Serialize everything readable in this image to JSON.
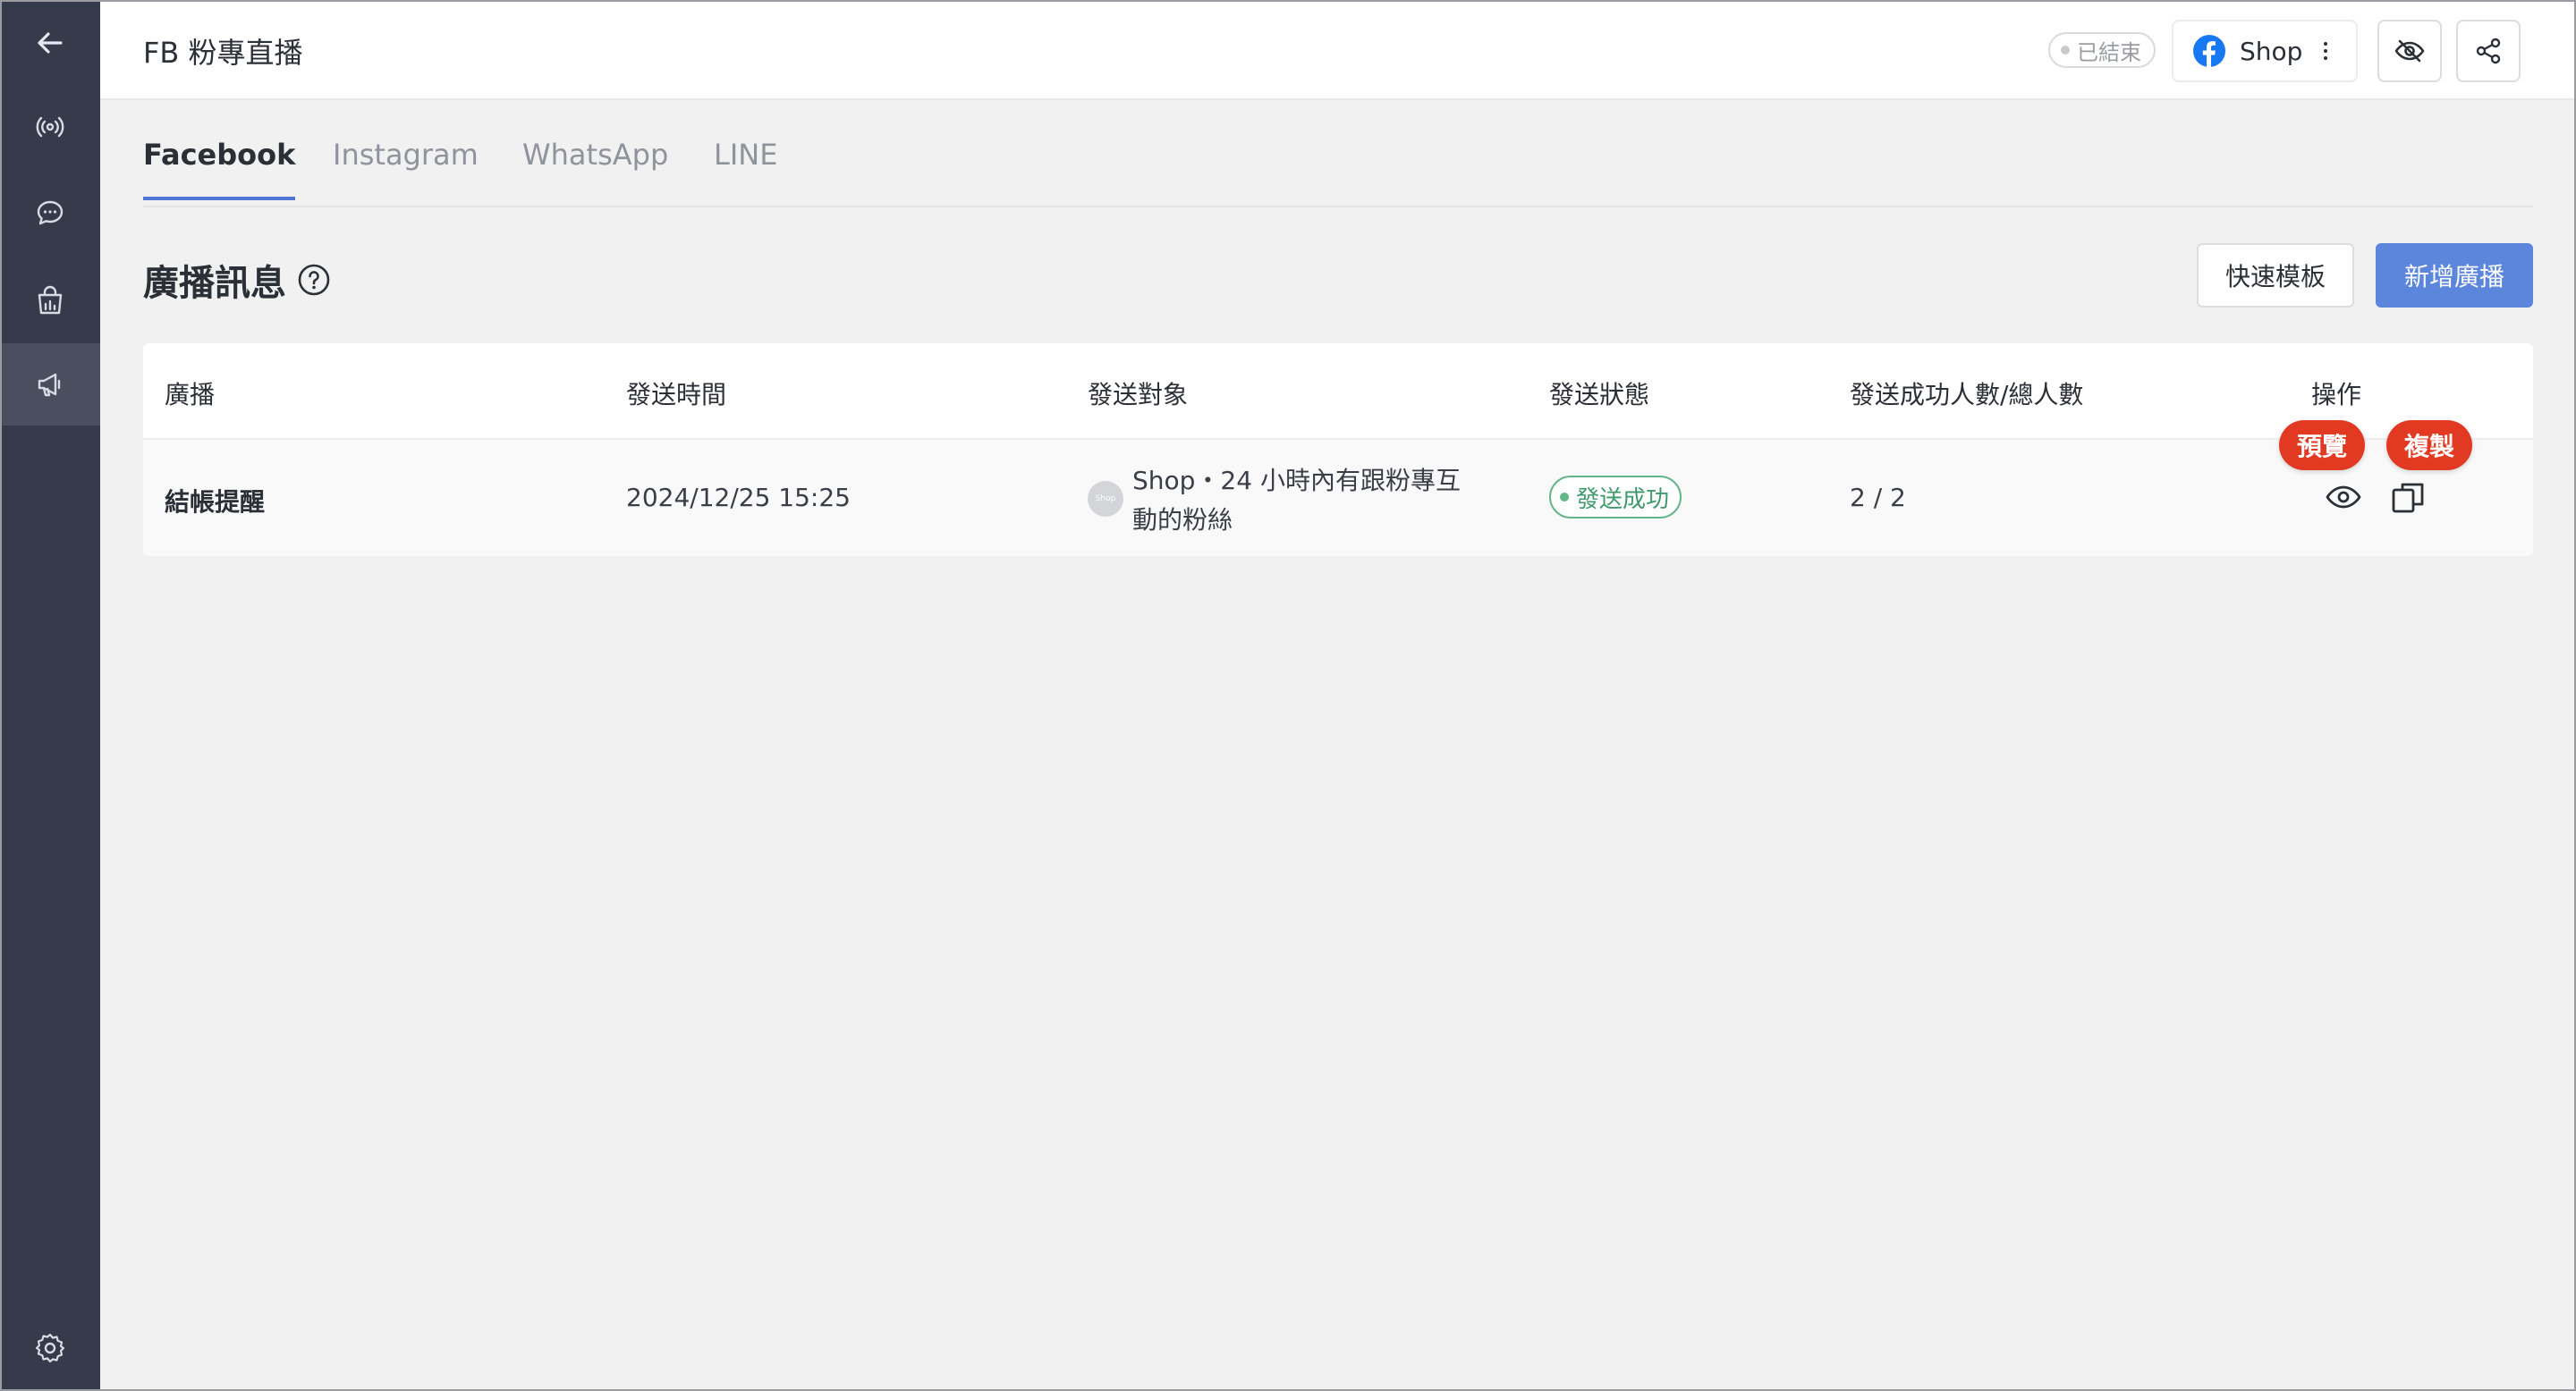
{
  "header": {
    "title": "FB 粉專直播",
    "status": "已結束",
    "page_name": "Shop"
  },
  "tabs": [
    {
      "label": "Facebook",
      "active": true
    },
    {
      "label": "Instagram",
      "active": false
    },
    {
      "label": "WhatsApp",
      "active": false
    },
    {
      "label": "LINE",
      "active": false
    }
  ],
  "section": {
    "title": "廣播訊息",
    "template_button": "快速模板",
    "new_button": "新增廣播"
  },
  "table": {
    "columns": [
      "廣播",
      "發送時間",
      "發送對象",
      "發送狀態",
      "發送成功人數/總人數",
      "操作"
    ],
    "rows": [
      {
        "name": "結帳提醒",
        "time": "2024/12/25 15:25",
        "avatar_text": "Shop",
        "target": "Shop・24 小時內有跟粉專互動的粉絲",
        "status": "發送成功",
        "count": "2 / 2"
      }
    ]
  },
  "actions": {
    "preview_tooltip": "預覽",
    "copy_tooltip": "複製"
  },
  "colors": {
    "sidebar": "#363b4b",
    "accent": "#5b86dc",
    "success": "#62b68a",
    "tooltip": "#e23a22",
    "facebook": "#1877f2"
  },
  "icons": {
    "sidebar": [
      "back-arrow-icon",
      "broadcast-live-icon",
      "chat-bubble-icon",
      "shopping-bag-icon",
      "megaphone-icon",
      "gear-icon"
    ],
    "header": [
      "facebook-icon",
      "eye-off-icon",
      "share-icon"
    ]
  }
}
